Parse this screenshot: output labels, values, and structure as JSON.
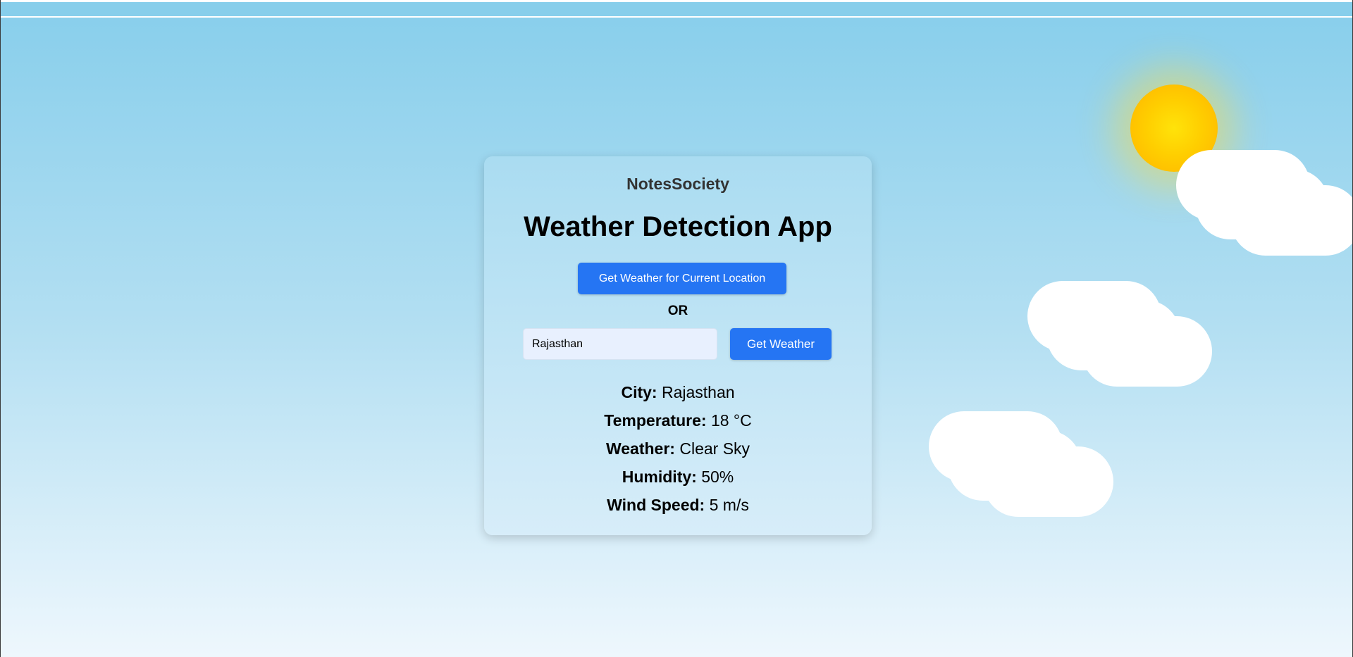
{
  "brand": "NotesSociety",
  "title": "Weather Detection App",
  "buttons": {
    "current_location": "Get Weather for Current Location",
    "get_weather": "Get Weather"
  },
  "or_label": "OR",
  "search": {
    "value": "Rajasthan",
    "placeholder": ""
  },
  "weather": {
    "city_label": "City:",
    "city": "Rajasthan",
    "temperature_label": "Temperature:",
    "temperature": "18 °C",
    "condition_label": "Weather:",
    "condition": "Clear Sky",
    "humidity_label": "Humidity:",
    "humidity": "50%",
    "wind_label": "Wind Speed:",
    "wind": "5 m/s"
  },
  "colors": {
    "button": "#2575f3",
    "sky_top": "#87ceeb",
    "sun": "#ffce00"
  }
}
